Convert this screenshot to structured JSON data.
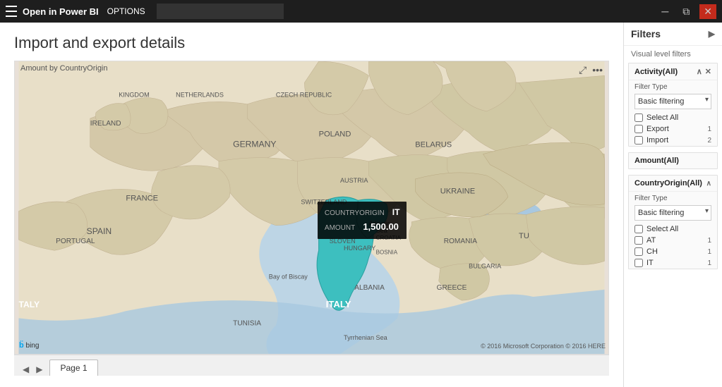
{
  "titlebar": {
    "app_title": "Open in Power BI",
    "options_label": "OPTIONS",
    "search_placeholder": "",
    "controls": {
      "restore": "🗗",
      "close": "✕"
    }
  },
  "report": {
    "title": "Import and export details",
    "map_label": "Amount by CountryOrigin",
    "tooltip": {
      "countryorigin_label": "COUNTRYORIGIN",
      "countryorigin_value": "IT",
      "amount_label": "AMOUNT",
      "amount_value": "1,500.00"
    },
    "bing_label": "b̈ bing",
    "copyright": "© 2016 Microsoft Corporation  © 2016 HERE"
  },
  "page_tabs": {
    "nav_prev": "◀",
    "nav_next": "▶",
    "tabs": [
      {
        "label": "Page 1",
        "active": true
      }
    ]
  },
  "filters": {
    "title": "Filters",
    "expand_icon": "▶",
    "visual_level_label": "Visual level filters",
    "activity_filter": {
      "header": "Activity(All)",
      "close_icon": "✕",
      "collapse_icon": "∧",
      "filter_type_label": "Filter Type",
      "filter_type_option": "Basic filtering",
      "options": [
        {
          "label": "Select All",
          "checked": false,
          "count": ""
        },
        {
          "label": "Export",
          "checked": false,
          "count": "1"
        },
        {
          "label": "Import",
          "checked": false,
          "count": "2"
        }
      ]
    },
    "amount_filter": {
      "header": "Amount(All)"
    },
    "country_filter": {
      "header": "CountryOrigin(All)",
      "collapse_icon": "∧",
      "filter_type_label": "Filter Type",
      "filter_type_option": "Basic filtering",
      "options": [
        {
          "label": "Select All",
          "checked": false,
          "count": ""
        },
        {
          "label": "AT",
          "checked": false,
          "count": "1"
        },
        {
          "label": "CH",
          "checked": false,
          "count": "1"
        },
        {
          "label": "IT",
          "checked": false,
          "count": "1"
        }
      ]
    }
  }
}
